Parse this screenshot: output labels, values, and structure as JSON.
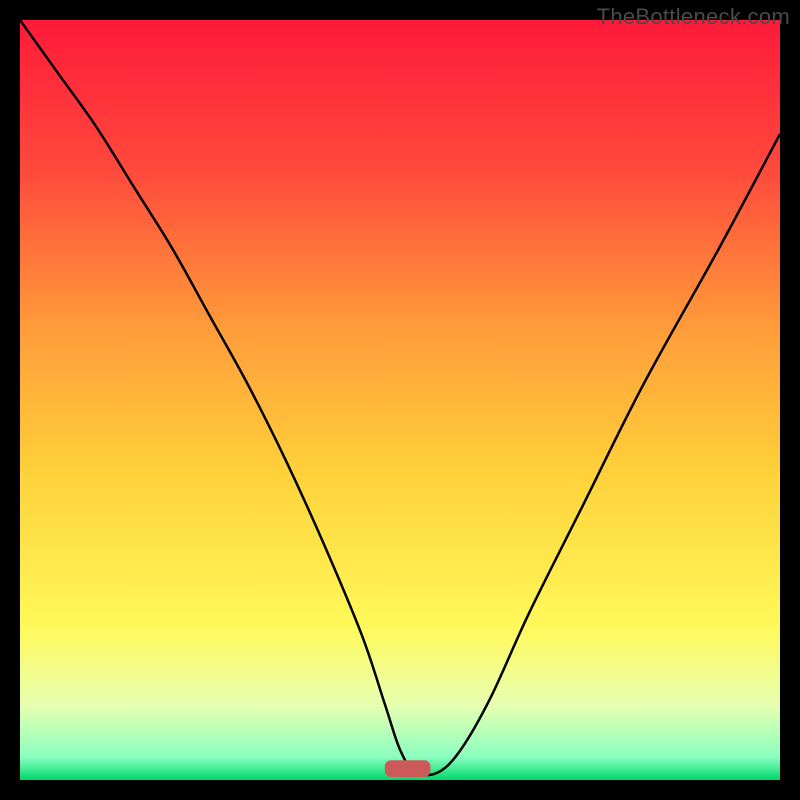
{
  "watermark": "TheBottleneck.com",
  "chart_data": {
    "type": "line",
    "title": "",
    "xlabel": "",
    "ylabel": "",
    "xlim": [
      0,
      100
    ],
    "ylim": [
      0,
      100
    ],
    "background_gradient": {
      "stops": [
        {
          "pos": 0.0,
          "color": "#ff1a3a"
        },
        {
          "pos": 0.2,
          "color": "#ff4a3c"
        },
        {
          "pos": 0.4,
          "color": "#ff9a3a"
        },
        {
          "pos": 0.6,
          "color": "#ffd23a"
        },
        {
          "pos": 0.8,
          "color": "#fff95a"
        },
        {
          "pos": 0.9,
          "color": "#e8ffb0"
        },
        {
          "pos": 0.97,
          "color": "#8affc0"
        },
        {
          "pos": 1.0,
          "color": "#00d86a"
        }
      ]
    },
    "series": [
      {
        "name": "bottleneck-curve",
        "color": "#000000",
        "stroke_width": 2.5,
        "x": [
          0,
          5,
          10,
          15,
          20,
          25,
          30,
          35,
          40,
          45,
          48,
          50,
          52,
          55,
          58,
          62,
          67,
          74,
          82,
          92,
          100
        ],
        "y": [
          100,
          93,
          86,
          78,
          70,
          61,
          52,
          42,
          31,
          19,
          10,
          4,
          1,
          1,
          4,
          11,
          22,
          36,
          52,
          70,
          85
        ]
      }
    ],
    "marker": {
      "name": "min-point-marker",
      "shape": "rounded-rect",
      "color": "#cc5a5a",
      "x_center": 51,
      "y": 1.5,
      "width_x_units": 6,
      "height_y_units": 2.2
    }
  }
}
